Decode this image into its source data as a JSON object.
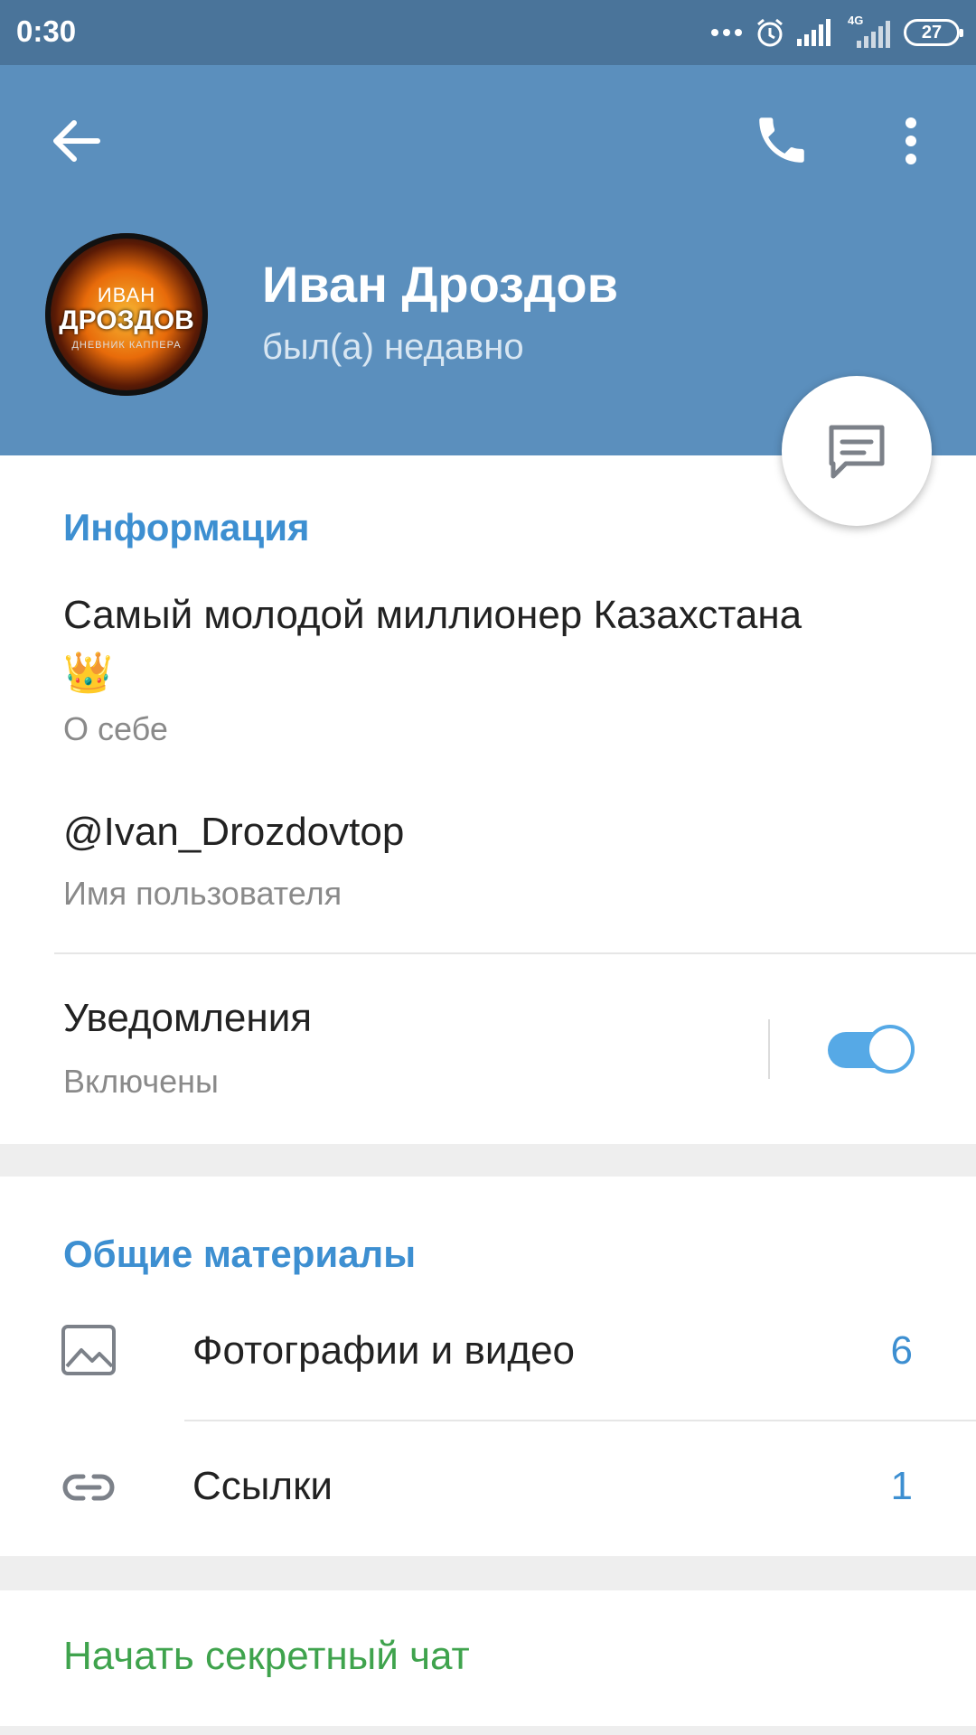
{
  "status_bar": {
    "time": "0:30",
    "network": "4G",
    "battery": "27"
  },
  "header": {
    "name": "Иван Дроздов",
    "last_seen": "был(а) недавно",
    "avatar_text": [
      "ИВАН",
      "ДРОЗДОВ",
      "ДНЕВНИК КАППЕРА"
    ]
  },
  "info": {
    "title": "Информация",
    "bio": "Самый молодой миллионер Казахстана",
    "bio_emoji": "👑",
    "bio_label": "О себе",
    "username": "@Ivan_Drozdovtop",
    "username_label": "Имя пользователя",
    "notifications_label": "Уведомления",
    "notifications_value": "Включены",
    "notifications_on": true
  },
  "shared": {
    "title": "Общие материалы",
    "items": [
      {
        "label": "Фотографии и видео",
        "count": "6",
        "icon": "image-icon"
      },
      {
        "label": "Ссылки",
        "count": "1",
        "icon": "link-icon"
      }
    ]
  },
  "actions": {
    "secret_chat": "Начать секретный чат"
  },
  "colors": {
    "header": "#5b8fbd",
    "status_bar": "#4a749a",
    "accent": "#3d8fd1",
    "secret": "#3fa34d"
  }
}
